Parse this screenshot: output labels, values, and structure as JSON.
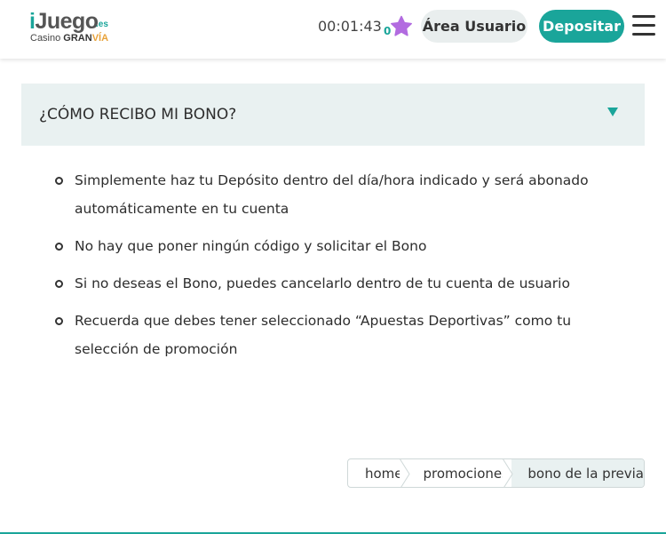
{
  "header": {
    "logo": {
      "brand_i": "i",
      "brand_rest": "Juego",
      "tld": ".es",
      "sub_prefix": "Casino ",
      "sub_gran": "GRAN",
      "sub_via": "VÍA"
    },
    "timer": "00:01:43",
    "star_count": "0",
    "area_usuario_label": "Área Usuario",
    "depositar_label": "Depositar"
  },
  "faq": {
    "title": "¿CÓMO RECIBO MI BONO?",
    "items": [
      "Simplemente haz tu Depósito dentro del día/hora indicado y será abonado automáticamente en tu cuenta",
      "No hay que poner ningún código y solicitar el Bono",
      "Si no deseas el Bono, puedes cancelarlo dentro de tu cuenta de usuario",
      "Recuerda que debes tener seleccionado “Apuestas Deportivas” como tu selección de promoción"
    ]
  },
  "breadcrumb": {
    "items": [
      "home",
      "promociones",
      "bono de la previa"
    ]
  },
  "colors": {
    "accent": "#1aa59a",
    "star": "#b26be0",
    "panel_bg": "#e9f1f1"
  },
  "icons": {
    "star": "star-icon",
    "menu": "hamburger-menu-icon",
    "toggle": "triangle-down-icon"
  }
}
